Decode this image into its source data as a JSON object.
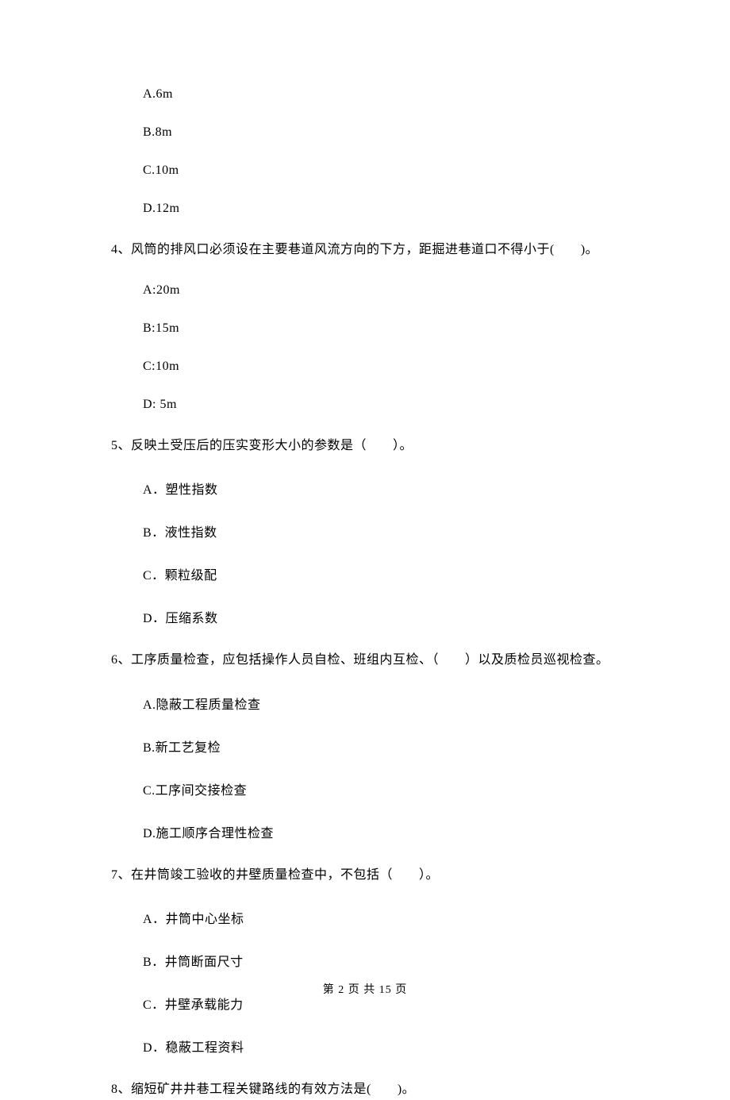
{
  "q3_options": {
    "a": "A.6m",
    "b": "B.8m",
    "c": "C.10m",
    "d": "D.12m"
  },
  "q4": {
    "text": "4、风筒的排风口必须设在主要巷道风流方向的下方，距掘进巷道口不得小于(　　)。",
    "a": "A:20m",
    "b": "B:15m",
    "c": "C:10m",
    "d": "D: 5m"
  },
  "q5": {
    "text": "5、反映土受压后的压实变形大小的参数是（　　）。",
    "a": "A．塑性指数",
    "b": "B．液性指数",
    "c": "C．颗粒级配",
    "d": "D．压缩系数"
  },
  "q6": {
    "text": "6、工序质量检查，应包括操作人员自检、班组内互检、（　　）以及质检员巡视检查。",
    "a": "A.隐蔽工程质量检查",
    "b": "B.新工艺复检",
    "c": "C.工序间交接检查",
    "d": "D.施工顺序合理性检查"
  },
  "q7": {
    "text": "7、在井筒竣工验收的井壁质量检查中，不包括（　　）。",
    "a": "A．井筒中心坐标",
    "b": "B．井筒断面尺寸",
    "c": "C．井壁承载能力",
    "d": "D．稳蔽工程资料"
  },
  "q8": {
    "text": "8、缩短矿井井巷工程关键路线的有效方法是(　　)。"
  },
  "footer": "第 2 页 共 15 页"
}
